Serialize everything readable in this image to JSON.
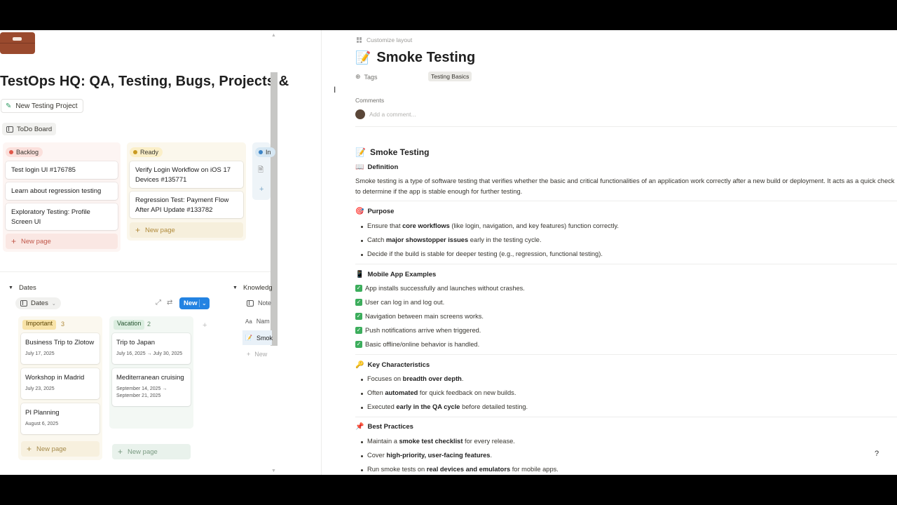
{
  "left": {
    "page_title": "TestOps HQ: QA, Testing, Bugs, Projects &",
    "new_project_label": "New Testing Project",
    "view_tab_label": "ToDo Board",
    "board": {
      "columns": [
        {
          "name": "Backlog",
          "color": "#e0574a",
          "cards": [
            "Test login UI #176785",
            "Learn about regression testing",
            "Exploratory Testing: Profile Screen UI"
          ],
          "new_page": "New page"
        },
        {
          "name": "Ready",
          "color": "#c99a22",
          "cards": [
            "Verify Login Workflow on iOS 17 Devices #135771",
            "Regression Test: Payment Flow After API Update #133782"
          ],
          "new_page": "New page"
        },
        {
          "name": "In",
          "color": "#3d84c6"
        }
      ]
    },
    "dates_section": {
      "label": "Dates",
      "view_chip": "Dates",
      "new_button": "New",
      "groups": [
        {
          "name": "Important",
          "count": "3",
          "cards": [
            {
              "title": "Business Trip to Zlotow",
              "date": "July 17, 2025"
            },
            {
              "title": "Workshop in Madrid",
              "date": "July 23, 2025"
            },
            {
              "title": "PI Planning",
              "date": "August 6, 2025"
            }
          ],
          "new_page": "New page"
        },
        {
          "name": "Vacation",
          "count": "2",
          "cards": [
            {
              "title": "Trip to Japan",
              "date": "July 16, 2025 → July 30, 2025"
            },
            {
              "title": "Mediterranean cruising",
              "date": "September 14, 2025 → September 21, 2025"
            }
          ],
          "new_page": "New page"
        }
      ]
    },
    "knowledge_section": {
      "label": "Knowledg",
      "view_label": "Note",
      "column_header": "Nam",
      "row": "Smok",
      "new_label": "New"
    }
  },
  "right": {
    "customize_label": "Customize layout",
    "title": "Smoke Testing",
    "title_emoji": "📝",
    "tags_label": "Tags",
    "tag_value": "Testing Basics",
    "comments_label": "Comments",
    "comment_placeholder": "Add a comment...",
    "heading": "Smoke Testing",
    "definition": {
      "heading": "Definition",
      "text": "Smoke testing is a type of software testing that verifies whether the basic and critical functionalities of an application work correctly after a new build or deployment. It acts as a quick check to determine if the app is stable enough for further testing."
    },
    "purpose": {
      "heading": "Purpose",
      "items": [
        {
          "pre": "Ensure that ",
          "bold": "core workflows",
          "post": " (like login, navigation, and key features) function correctly."
        },
        {
          "pre": "Catch ",
          "bold": "major showstopper issues",
          "post": " early in the testing cycle."
        },
        {
          "pre": "Decide if the build is stable for deeper testing (e.g., regression, functional testing).",
          "bold": "",
          "post": ""
        }
      ]
    },
    "mobile_examples": {
      "heading": "Mobile App Examples",
      "items": [
        "App installs successfully and launches without crashes.",
        "User can log in and log out.",
        "Navigation between main screens works.",
        "Push notifications arrive when triggered.",
        "Basic offline/online behavior is handled."
      ]
    },
    "characteristics": {
      "heading": "Key Characteristics",
      "items": [
        {
          "pre": "Focuses on ",
          "bold": "breadth over depth",
          "post": "."
        },
        {
          "pre": "Often ",
          "bold": "automated",
          "post": " for quick feedback on new builds."
        },
        {
          "pre": "Executed ",
          "bold": "early in the QA cycle",
          "post": " before detailed testing."
        }
      ]
    },
    "best_practices": {
      "heading": "Best Practices",
      "items": [
        {
          "pre": "Maintain a ",
          "bold": "smoke test checklist",
          "post": " for every release."
        },
        {
          "pre": "Cover ",
          "bold": "high-priority, user-facing features",
          "post": "."
        },
        {
          "pre": "Run smoke tests on ",
          "bold": "real devices and emulators",
          "post": " for mobile apps."
        }
      ]
    }
  }
}
